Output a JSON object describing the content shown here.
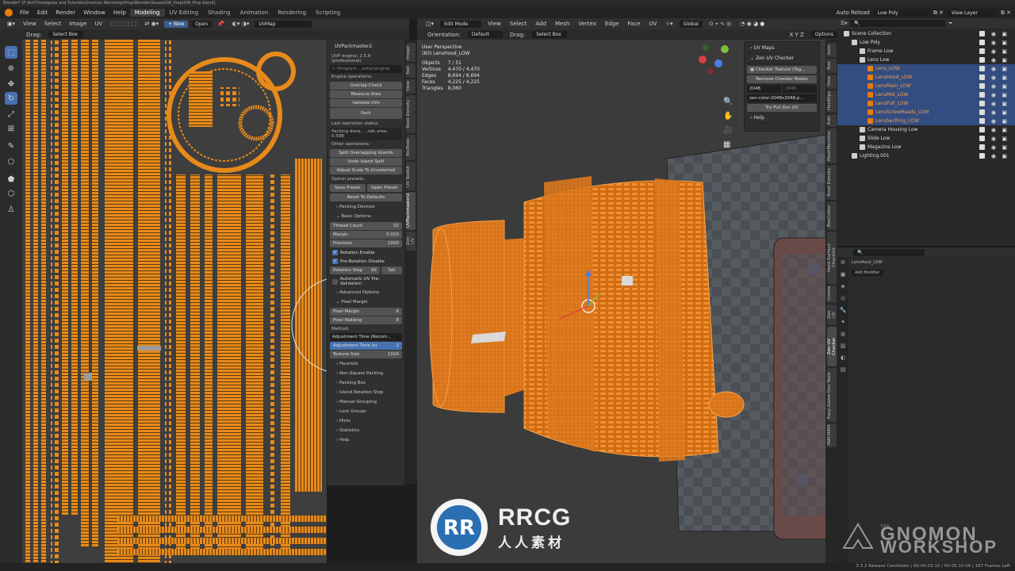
{
  "window": {
    "title": "Blender* [F:\\Art\\Timelapses and Tutorials\\Gnomon Workshop\\Prop\\Blender\\Saves\\GW_Prop\\GW_Prop.blend]"
  },
  "topbar": {
    "menus": [
      "File",
      "Edit",
      "Render",
      "Window",
      "Help"
    ],
    "workspaces": [
      "Modeling",
      "UV Editing",
      "Shading",
      "Animation",
      "Rendering",
      "Scripting"
    ],
    "active_workspace": "Modeling",
    "auto_reload": "Auto Reload",
    "scene": "Low Poly",
    "view_layer": "View Layer"
  },
  "uv_editor": {
    "header_menus": [
      "View",
      "Select",
      "Image",
      "UV"
    ],
    "new_label": "+ New",
    "open_label": "Open",
    "uvmap": "UVMap",
    "drag_label": "Drag:",
    "drag_value": "Select Box"
  },
  "packmaster": {
    "title": "UVPackmaster2",
    "engine": "UVP engine: 2.5.8 (professional)",
    "path": "C:\\Program ...aster\\engine",
    "engine_ops_label": "Engine operations:",
    "overlap_check": "Overlap Check",
    "measure_area": "Measure Area",
    "validate_uvs": "Validate UVs",
    "pack": "Pack",
    "last_status_label": "Last operation status:",
    "last_status": "Packing done, ...nds area: 0.598",
    "other_ops_label": "Other operations:",
    "split_overlapping": "Split Overlapping Islands",
    "undo_split": "Undo Island Split",
    "adjust_scale": "Adjust Scale To Unselected",
    "presets_label": "Option presets:",
    "save_preset": "Save Preset",
    "open_preset": "Open Preset",
    "reset_defaults": "Reset To Defaults",
    "packing_devices": "Packing Devices",
    "basic_options": "Basic Options",
    "thread_count_label": "Thread Count",
    "thread_count": "32",
    "margin_label": "Margin",
    "margin": "0.010",
    "precision_label": "Precision",
    "precision": "1000",
    "rotation_enable": "Rotation Enable",
    "pre_rotation_disable": "Pre-Rotation Disable",
    "rotation_step_label": "Rotation Step",
    "rotation_step": "90",
    "set_label": "Set",
    "auto_validation": "Automatic UV Pre-Validation",
    "advanced_options": "Advanced Options",
    "pixel_margin_section": "Pixel Margin",
    "pixel_margin_label": "Pixel Margin",
    "pixel_margin": "6",
    "pixel_padding_label": "Pixel Padding",
    "pixel_padding": "8",
    "method_label": "Method:",
    "method_value": "Adjustment Time (Recom...",
    "adjust_time_label": "Adjustment Time (s)",
    "adjust_time": "2",
    "texture_size_label": "Texture Size",
    "texture_size": "1024",
    "sections": [
      "Heuristic",
      "Non-Square Packing",
      "Packing Box",
      "Island Rotation Step",
      "Manual Grouping",
      "Lock Groups",
      "Hints",
      "Statistics",
      "Help"
    ]
  },
  "uv_vtabs": [
    "Image",
    "Tool",
    "View",
    "Texel Density",
    "TexTools",
    "UV Toolkit",
    "UVPackmaster2",
    "Zen UV"
  ],
  "viewport": {
    "mode": "Edit Mode",
    "menus": [
      "View",
      "Select",
      "Add",
      "Mesh",
      "Vertex",
      "Edge",
      "Face",
      "UV"
    ],
    "orientation_label": "Orientation:",
    "orientation": "Default",
    "drag_label": "Drag:",
    "drag_value": "Select Box",
    "global": "Global",
    "options": "Options",
    "perspective": "User Perspective",
    "object_name": "(83) LensHood_LOW",
    "stats": [
      {
        "k": "Objects",
        "v": "7 / 51"
      },
      {
        "k": "Vertices",
        "v": "4,470 / 4,470"
      },
      {
        "k": "Edges",
        "v": "8,694 / 8,694"
      },
      {
        "k": "Faces",
        "v": "4,225 / 4,225"
      },
      {
        "k": "Triangles",
        "v": "8,060"
      }
    ]
  },
  "zen_panel": {
    "uv_maps": "UV Maps",
    "zen_checker": "Zen UV Checker",
    "checker_texture": "Checker Texture (Tog...",
    "remove_nodes": "Remove Checker Nodes",
    "res_a": "2048",
    "res_b": "2048",
    "image_name": "zen-color-2048x2048.p...",
    "try_full": "Try Full Zen UV",
    "help": "Help"
  },
  "vp_vtabs": [
    "Item",
    "Tool",
    "View",
    "HardOps",
    "Edit",
    "MeshMachine",
    "Texel Density",
    "BoxCutter",
    "Hard Surface Checklist",
    "Create",
    "Zen UV",
    "Zen UV Checker",
    "Easy Game Dev Tools",
    "MACHIN3"
  ],
  "outliner": {
    "rows": [
      {
        "name": "Scene Collection",
        "indent": 0,
        "type": "collection",
        "sel": false
      },
      {
        "name": "Low Poly",
        "indent": 1,
        "type": "collection",
        "sel": false
      },
      {
        "name": "Frame Low",
        "indent": 2,
        "type": "collection",
        "sel": false
      },
      {
        "name": "Lens Low",
        "indent": 2,
        "type": "collection",
        "sel": false
      },
      {
        "name": "Lens_LOW",
        "indent": 3,
        "type": "mesh",
        "sel": true
      },
      {
        "name": "LensHood_LOW",
        "indent": 3,
        "type": "mesh",
        "sel": true
      },
      {
        "name": "LensMain_LOW",
        "indent": 3,
        "type": "mesh",
        "sel": true
      },
      {
        "name": "LensMid_LOW",
        "indent": 3,
        "type": "mesh",
        "sel": true
      },
      {
        "name": "LensPull_LOW",
        "indent": 3,
        "type": "mesh",
        "sel": true
      },
      {
        "name": "LensScrewHeads_LOW",
        "indent": 3,
        "type": "mesh",
        "sel": true
      },
      {
        "name": "LensSecRing_LOW",
        "indent": 3,
        "type": "mesh",
        "sel": true
      },
      {
        "name": "Camera Housing Low",
        "indent": 2,
        "type": "collection",
        "sel": false
      },
      {
        "name": "Slide Low",
        "indent": 2,
        "type": "collection",
        "sel": false
      },
      {
        "name": "Magazine Low",
        "indent": 2,
        "type": "collection",
        "sel": false
      },
      {
        "name": "Lighting.001",
        "indent": 1,
        "type": "collection",
        "sel": false
      }
    ]
  },
  "props": {
    "object": "LensHood_LOW",
    "modifier": "Add Modifier"
  },
  "statusbar": {
    "right": "3.3.2 Release Candidate | 00:00:03:10 / 00:00:10:09 | 167 Frames Left"
  },
  "watermark": {
    "brand": "RRCG",
    "sub": "人人素材",
    "gnomon_1": "THE",
    "gnomon_2": "GNOMON",
    "gnomon_3": "WORKSHOP"
  },
  "colors": {
    "uv_orange": "#e88a1a",
    "select_blue": "#4772b3",
    "mesh_orange": "#e07a10"
  }
}
